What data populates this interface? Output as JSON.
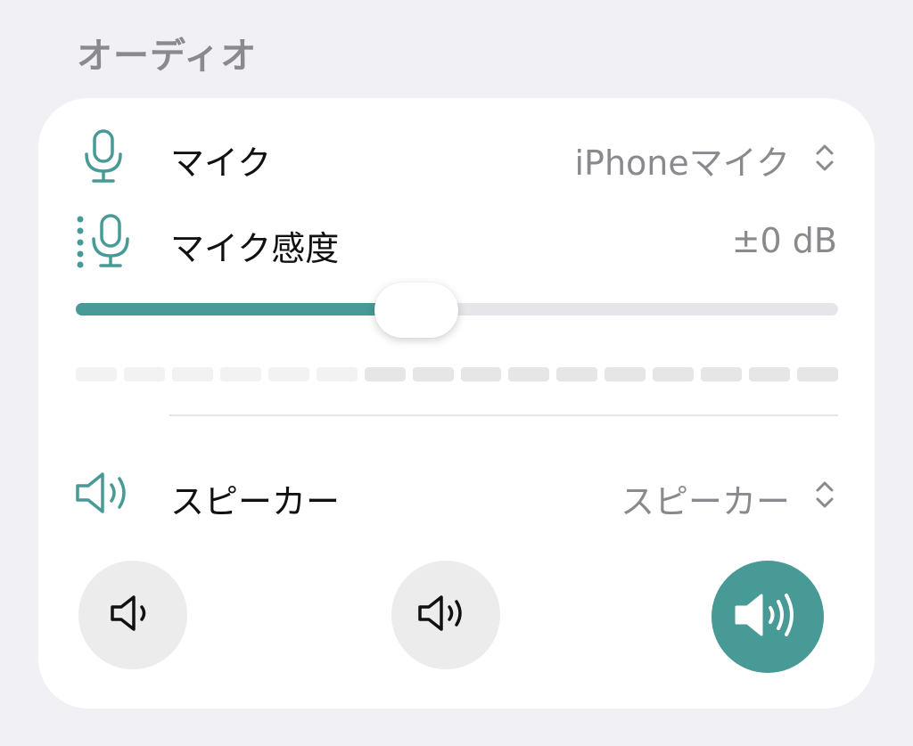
{
  "section": {
    "title": "オーディオ"
  },
  "mic": {
    "label": "マイク",
    "value": "iPhoneマイク",
    "icon": "microphone-icon"
  },
  "sensitivity": {
    "label": "マイク感度",
    "value": "±0 dB",
    "level": 0.447,
    "icon": "mic-sensitivity-icon"
  },
  "meter": {
    "segments": 16,
    "dim_segments": 6
  },
  "speaker": {
    "label": "スピーカー",
    "value": "スピーカー",
    "icon": "speaker-icon"
  },
  "volume_presets": [
    {
      "name": "low",
      "icon": "speaker-low-icon",
      "selected": false
    },
    {
      "name": "medium",
      "icon": "speaker-medium-icon",
      "selected": false
    },
    {
      "name": "high",
      "icon": "speaker-high-icon",
      "selected": true
    }
  ],
  "colors": {
    "accent": "#479a95",
    "label": "#111111",
    "secondary": "#8a8a8e",
    "background": "#f0f0f5"
  }
}
